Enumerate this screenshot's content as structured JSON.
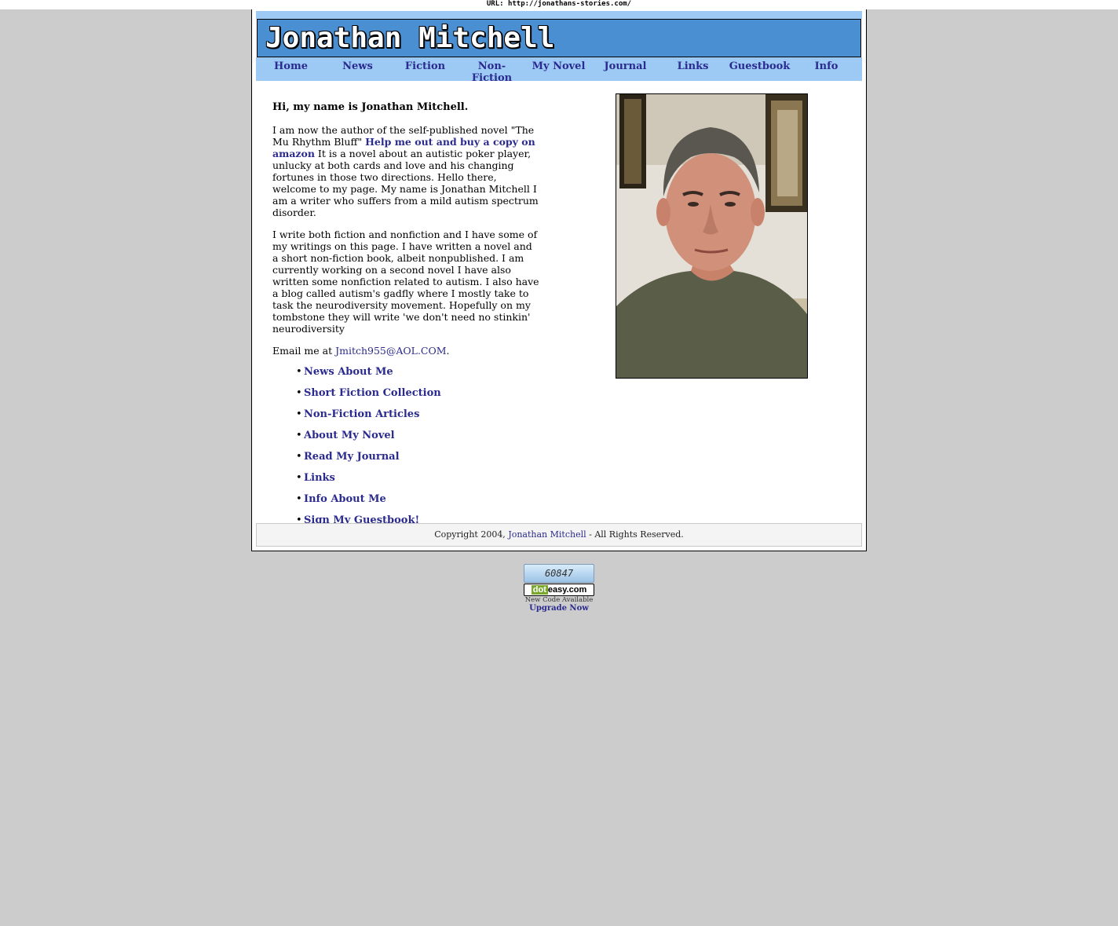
{
  "url_bar": "URL: http://jonathans-stories.com/",
  "site": {
    "logo_text": "Jonathan Mitchell"
  },
  "nav": [
    {
      "label": "Home"
    },
    {
      "label": "News"
    },
    {
      "label": "Fiction"
    },
    {
      "label": "Non-Fiction"
    },
    {
      "label": "My Novel"
    },
    {
      "label": "Journal"
    },
    {
      "label": "Links"
    },
    {
      "label": "Guestbook"
    },
    {
      "label": "Info"
    }
  ],
  "main": {
    "greeting": "Hi, my name is Jonathan Mitchell.",
    "para1_before": "I am now the author of the self-published novel \"The Mu Rhythm Bluff\" ",
    "para1_link": "Help me out and buy a copy on amazon",
    "para1_after": " It is a novel about an autistic poker player, unlucky at both cards and love and his changing fortunes in those two directions. Hello there, welcome to my page. My name is Jonathan Mitchell I am a writer who suffers from a mild autism spectrum disorder.",
    "para2": "I write both fiction and nonfiction and I have some of my writings on this page. I have written a novel and a short non-fiction book, albeit nonpublished. I am currently working on a second novel I have also written some nonfiction related to autism. I also have a blog called autism's gadfly where I mostly take to task the neurodiversity movement. Hopefully on my tombstone they will write 'we don't need no stinkin' neurodiversity",
    "email_prefix": "Email me at ",
    "email_link": "Jmitch955@AOL.COM",
    "email_suffix": ".",
    "links": [
      {
        "label": "News About Me"
      },
      {
        "label": "Short Fiction Collection"
      },
      {
        "label": "Non-Fiction Articles"
      },
      {
        "label": "About My Novel"
      },
      {
        "label": "Read My Journal"
      },
      {
        "label": "Links"
      },
      {
        "label": "Info About Me"
      },
      {
        "label": "Sign My Guestbook!"
      }
    ],
    "bullet": "•"
  },
  "footer": {
    "prefix": "Copyright 2004, ",
    "link": "Jonathan Mitchell",
    "suffix": " - All Rights Reserved."
  },
  "counter": {
    "value": "60847",
    "badge_dot": "dot",
    "badge_rest": "easy.com",
    "new_code": "New Code Available",
    "upgrade": "Upgrade Now"
  },
  "colors": {
    "background": "#cccccc",
    "banner": "#4a8fd2",
    "nav_bar": "#9ccaf5",
    "link": "#2a2a8f"
  }
}
